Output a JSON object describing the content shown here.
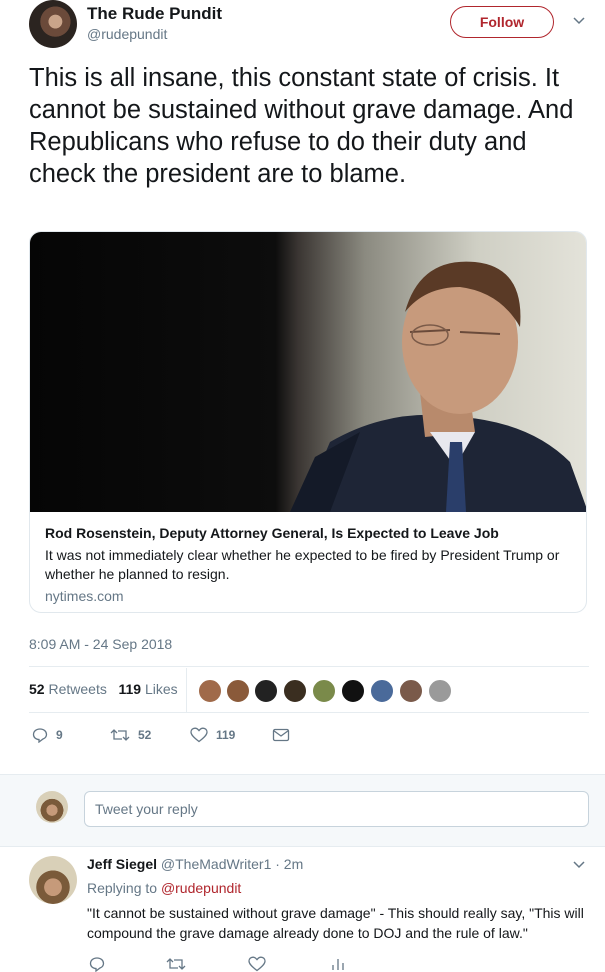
{
  "author": {
    "name": "The Rude Pundit",
    "handle": "@rudepundit"
  },
  "follow_label": "Follow",
  "tweet": {
    "text": "This is all insane, this constant state of crisis. It cannot be sustained without grave damage. And Republicans who refuse to do their duty and check the president are to blame."
  },
  "card": {
    "title": "Rod Rosenstein, Deputy Attorney General, Is Expected to Leave Job",
    "description": "It was not immediately clear whether he expected to be fired by President Trump or whether he planned to resign.",
    "domain": "nytimes.com"
  },
  "timestamp": "8:09 AM - 24 Sep 2018",
  "stats": {
    "retweets_count": "52",
    "retweets_label": "Retweets",
    "likes_count": "119",
    "likes_label": "Likes"
  },
  "actions": {
    "replies": "9",
    "retweets": "52",
    "likes": "119"
  },
  "reply_box": {
    "placeholder": "Tweet your reply"
  },
  "reply": {
    "name": "Jeff Siegel",
    "handle": "@TheMadWriter1",
    "time": "· 2m",
    "replying_label": "Replying to",
    "replying_to": "@rudepundit",
    "text": "\"It cannot be sustained without grave damage\" - This should really say, \"This will compound the grave damage already done to DOJ and the rule of law.\""
  },
  "colors": {
    "accent": "#b0262d",
    "muted": "#657786",
    "text": "#14171a"
  }
}
